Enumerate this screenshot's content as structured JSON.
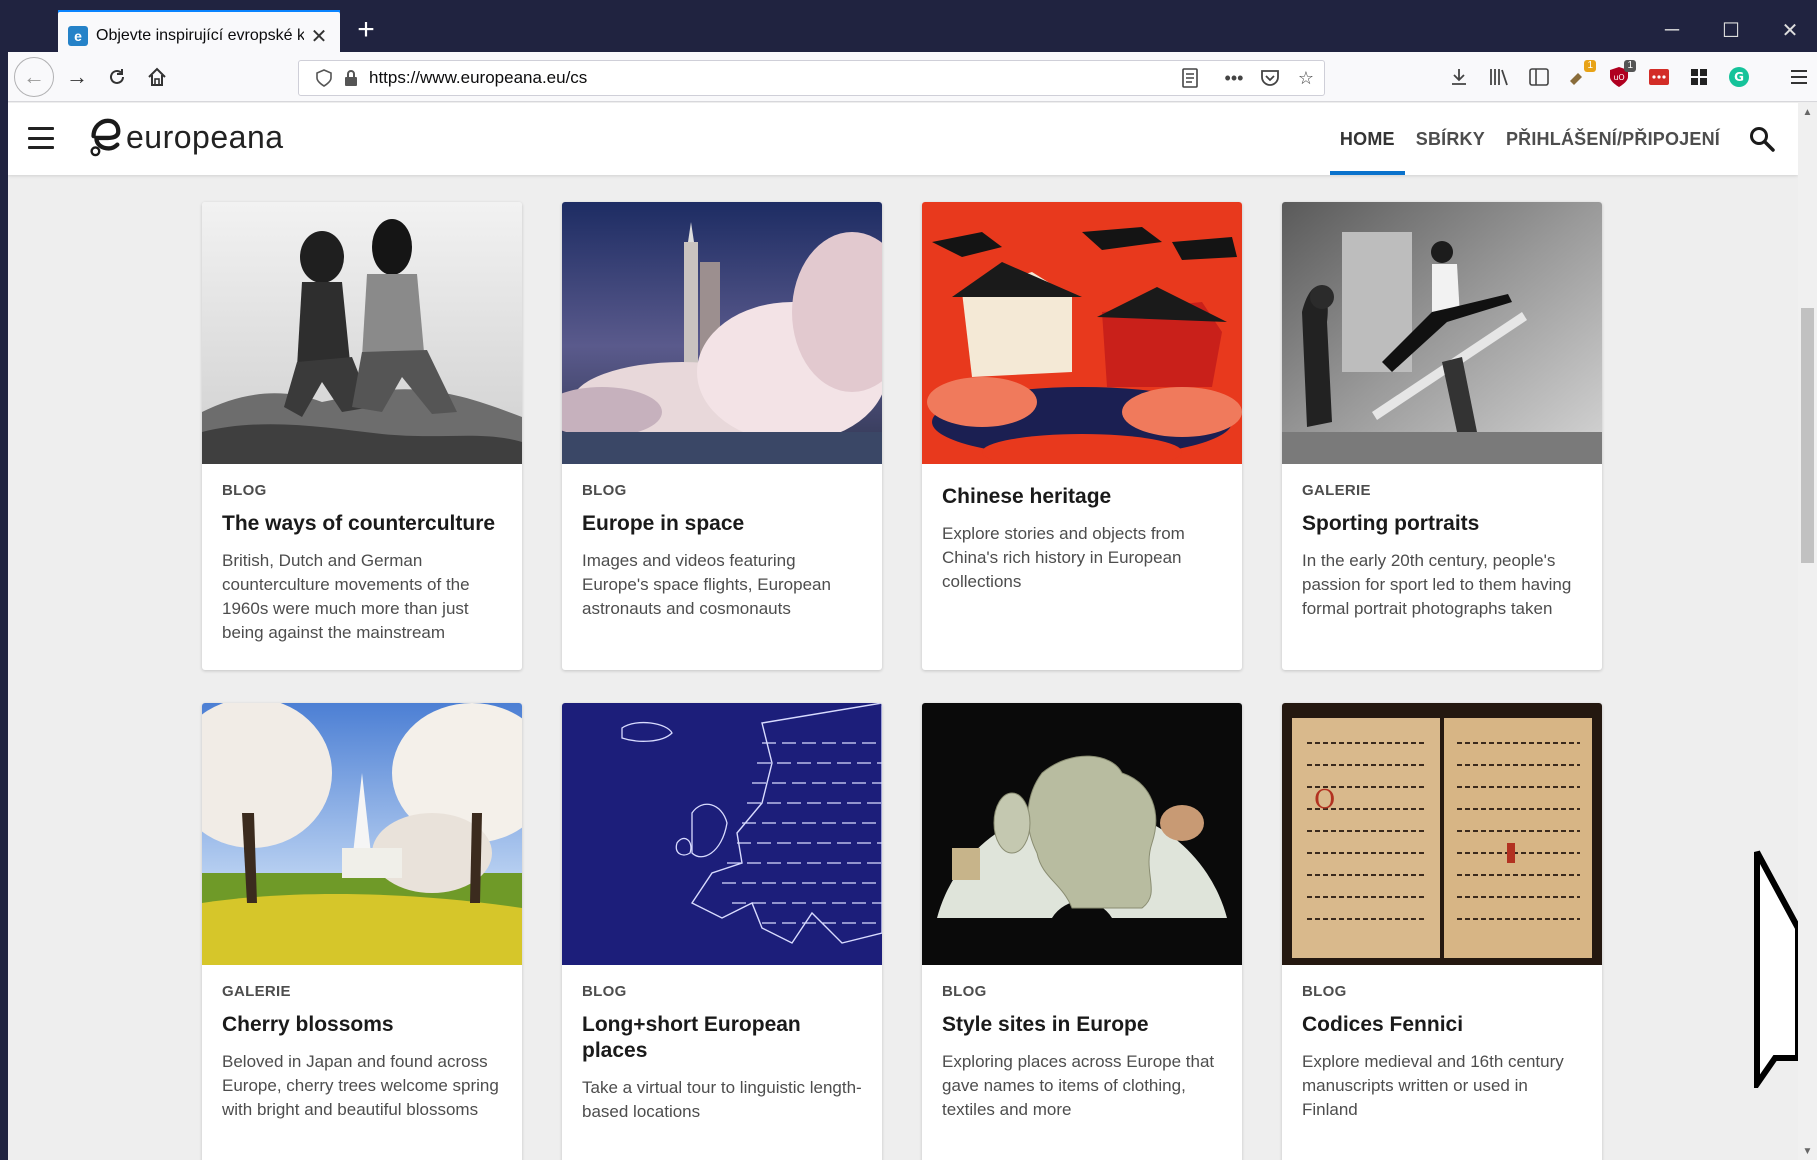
{
  "browser": {
    "tab_title": "Objevte inspirující evropské kul",
    "tab_favicon": "europeana-favicon",
    "url": "https://www.europeana.eu/cs",
    "extension_badge_1": "1",
    "extension_badge_2": "1"
  },
  "site": {
    "logo_text": "europeana",
    "nav": {
      "home": "HOME",
      "collections": "SBÍRKY",
      "login": "PŘIHLÁŠENÍ/PŘIPOJENÍ"
    },
    "accent_color": "#0a72cc"
  },
  "cards": [
    {
      "type": "BLOG",
      "title": "The ways of counterculture",
      "desc": "British, Dutch and German counterculture movements of the 1960s were much more than just being against the mainstream",
      "image": "black-and-white photo of two young people sitting on rocks"
    },
    {
      "type": "BLOG",
      "title": "Europe in space",
      "desc": "Images and videos featuring Europe's space flights, European astronauts and cosmonauts",
      "image": "rocket launch"
    },
    {
      "type": "",
      "title": "Chinese heritage",
      "desc": "Explore stories and objects from China's rich history in European collections",
      "image": "red Chinese illustration with buildings"
    },
    {
      "type": "GALERIE",
      "title": "Sporting portraits",
      "desc": "In the early 20th century, people's passion for sport led to them having formal portrait photographs taken",
      "image": "sepia photo of man on seesaw"
    },
    {
      "type": "GALERIE",
      "title": "Cherry blossoms",
      "desc": "Beloved in Japan and found across Europe, cherry trees welcome spring with bright and beautiful blossoms",
      "image": "blossoming cherry trees and church"
    },
    {
      "type": "BLOG",
      "title": "Long+short European places",
      "desc": "Take a virtual tour to linguistic length-based locations",
      "image": "blue map of Europe"
    },
    {
      "type": "BLOG",
      "title": "Style sites in Europe",
      "desc": "Exploring places across Europe that gave names to items of clothing, textiles and more",
      "image": "fan-shaped antique map"
    },
    {
      "type": "BLOG",
      "title": "Codices Fennici",
      "desc": "Explore medieval and 16th century manuscripts written or used in Finland",
      "image": "medieval manuscript with music notation"
    }
  ]
}
